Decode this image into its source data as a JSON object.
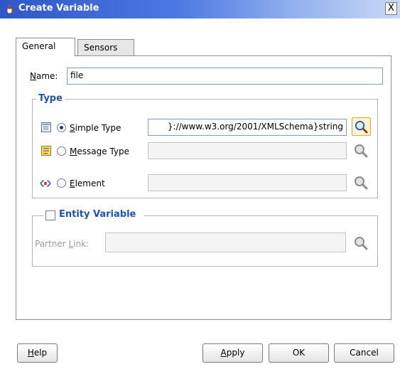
{
  "window": {
    "title": "Create Variable",
    "close_label": "X"
  },
  "tabs": [
    {
      "label": "General",
      "selected": true
    },
    {
      "label": "Sensors",
      "selected": false
    }
  ],
  "name": {
    "label_u": "N",
    "label_rest": "ame:",
    "value": "file"
  },
  "type_group": {
    "title": "Type",
    "options": [
      {
        "label_u": "S",
        "label_rest": "imple Type",
        "selected": true,
        "value": "}://www.w3.org/2001/XMLSchema}string",
        "icon": "simple-type-icon"
      },
      {
        "label_u": "M",
        "label_rest": "essage Type",
        "selected": false,
        "value": "",
        "icon": "message-type-icon"
      },
      {
        "label_u": "E",
        "label_rest": "lement",
        "selected": false,
        "value": "",
        "icon": "element-icon"
      }
    ]
  },
  "entity_group": {
    "title": "Entity Variable",
    "checked": false,
    "partner_link": {
      "label_pre": "Partner ",
      "label_u": "L",
      "label_rest": "ink:",
      "value": ""
    }
  },
  "buttons": {
    "help": {
      "u": "H",
      "rest": "elp"
    },
    "apply": {
      "u": "A",
      "rest": "pply"
    },
    "ok": "OK",
    "cancel": "Cancel"
  },
  "colors": {
    "accent": "#1e55b4",
    "titlebar": "#2f57c8",
    "search_highlight": "#fff1d3"
  }
}
